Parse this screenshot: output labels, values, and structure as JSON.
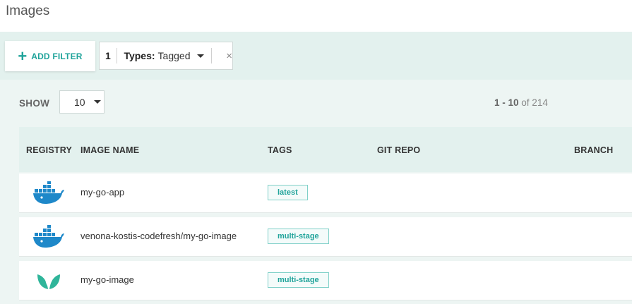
{
  "page": {
    "title": "Images"
  },
  "filters": {
    "add_filter_label": "ADD FILTER",
    "chip": {
      "count": "1",
      "type_key": "Types:",
      "type_value": "Tagged",
      "close_symbol": "×"
    }
  },
  "list_controls": {
    "show_label": "SHOW",
    "page_size": "10",
    "range": "1 - 10",
    "total_text": "of 214"
  },
  "table": {
    "headers": {
      "registry": "REGISTRY",
      "image_name": "IMAGE NAME",
      "tags": "TAGS",
      "git_repo": "GIT REPO",
      "branch": "BRANCH"
    },
    "rows": [
      {
        "registry_icon": "docker-icon",
        "image_name": "my-go-app",
        "tag": "latest"
      },
      {
        "registry_icon": "docker-icon",
        "image_name": "venona-kostis-codefresh/my-go-image",
        "tag": "multi-stage"
      },
      {
        "registry_icon": "codefresh-leaf-icon",
        "image_name": "my-go-image",
        "tag": "multi-stage"
      }
    ]
  },
  "colors": {
    "accent": "#1fa39a",
    "docker_blue": "#1e88c9",
    "panel_bg": "#e3f1ee"
  }
}
